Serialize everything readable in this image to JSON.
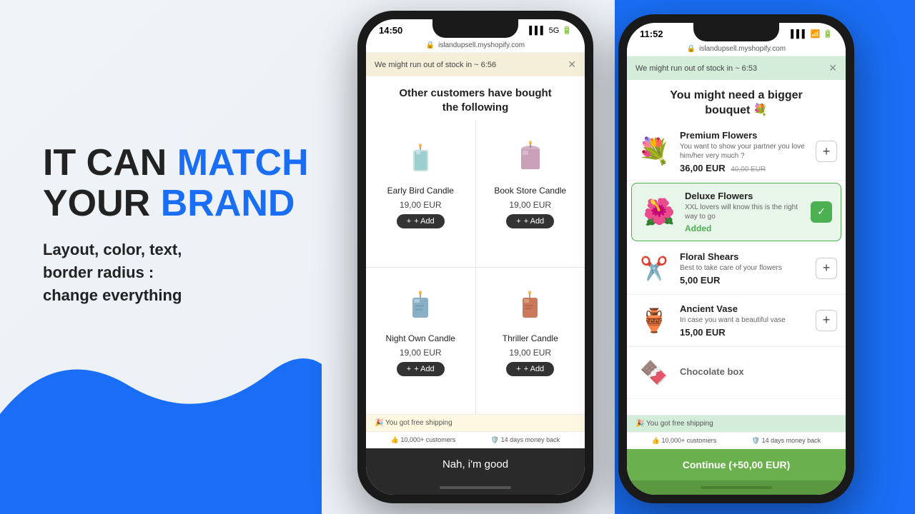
{
  "background": {
    "blueRight": "#1a6ef5"
  },
  "leftText": {
    "line1a": "IT CAN ",
    "line1b": "MATCH",
    "line2a": "YOUR ",
    "line2b": "BRAND",
    "subtext": "Layout, color, text,\nborder radius :\nchange everything"
  },
  "phoneLeft": {
    "time": "14:50",
    "url": "islandupsell.myshopify.com",
    "stockBanner": "We might run out of stock in ~ 6:56",
    "title": "Other customers have bought\nthe following",
    "products": [
      {
        "name": "Early Bird Candle",
        "price": "19,00 EUR",
        "emoji": "🕯️",
        "color": "#9ecfcf"
      },
      {
        "name": "Book Store Candle",
        "price": "19,00 EUR",
        "emoji": "🕯️",
        "color": "#c9a0b8"
      },
      {
        "name": "Night Own Candle",
        "price": "19,00 EUR",
        "emoji": "🕯️",
        "color": "#a0b8d0"
      },
      {
        "name": "Thriller Candle",
        "price": "19,00 EUR",
        "emoji": "🕯️",
        "color": "#c47a5a"
      }
    ],
    "addLabel": "+ Add",
    "freeShipping": "🎉 You got free shipping",
    "trust1": "👍 10,000+ customers",
    "trust2": "🛡️ 14 days money back",
    "nahBtn": "Nah, i'm good"
  },
  "phoneRight": {
    "time": "11:52",
    "url": "islandupsell.myshopify.com",
    "stockBanner": "We might run out of stock in ~ 6:53",
    "title": "You might need a bigger\nbouquet 💐",
    "products": [
      {
        "name": "Premium Flowers",
        "desc": "You want to show your partner you love him/her very much ?",
        "price": "36,00 EUR",
        "strikePrice": "40,00 EUR",
        "emoji": "💐",
        "selected": false,
        "added": false
      },
      {
        "name": "Deluxe Flowers",
        "desc": "XXL lovers will know this is the right way to go",
        "price": "Added",
        "selected": true,
        "added": true,
        "emoji": "🌺"
      },
      {
        "name": "Floral Shears",
        "desc": "Best to take care of your flowers",
        "price": "5,00 EUR",
        "selected": false,
        "added": false,
        "emoji": "✂️"
      },
      {
        "name": "Ancient Vase",
        "desc": "In case you want a beautiful vase",
        "price": "15,00 EUR",
        "selected": false,
        "added": false,
        "emoji": "🏺"
      },
      {
        "name": "Chocolate box",
        "desc": "",
        "price": "",
        "selected": false,
        "added": false,
        "emoji": "🍫"
      }
    ],
    "freeShipping": "🎉 You got free shipping",
    "trust1": "👍 10,000+ customers",
    "trust2": "🛡️ 14 days money back",
    "continueBtn": "Continue (+50,00 EUR)"
  }
}
